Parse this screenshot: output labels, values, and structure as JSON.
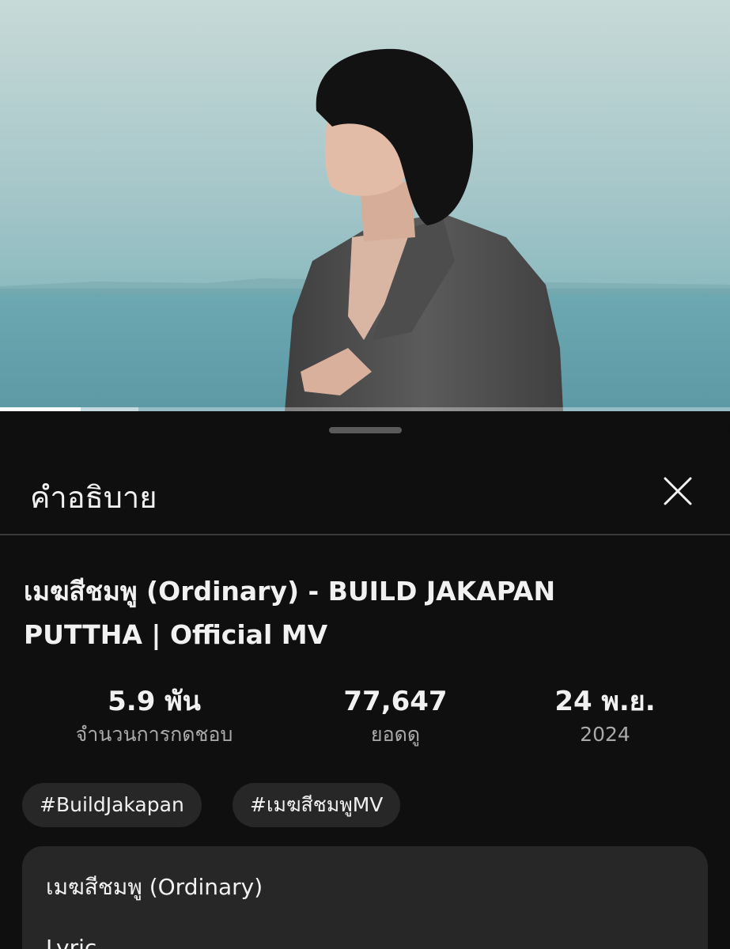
{
  "player": {
    "progress_fraction": 0.11,
    "buffered_fraction": 0.19
  },
  "sheet": {
    "title": "คำอธิบาย",
    "close_icon": "close-icon"
  },
  "video": {
    "title": "เมฆสีชมพู (Ordinary) - BUILD JAKAPAN PUTTHA | Official MV"
  },
  "stats": {
    "likes_value": "5.9 พัน",
    "likes_label": "จำนวนการกดชอบ",
    "views_value": "77,647",
    "views_label": "ยอดดู",
    "date_value": "24 พ.ย.",
    "date_year": "2024"
  },
  "hashtags": [
    "#BuildJakapan",
    "#เมฆสีชมพูMV"
  ],
  "description": {
    "first_line": "เมฆสีชมพู (Ordinary)",
    "second_line": "Lyric"
  },
  "colors": {
    "sheet_bg": "#0f0f0f",
    "chip_bg": "#272727",
    "text_primary": "#f1f1f1",
    "text_secondary": "#aaaaaa"
  }
}
